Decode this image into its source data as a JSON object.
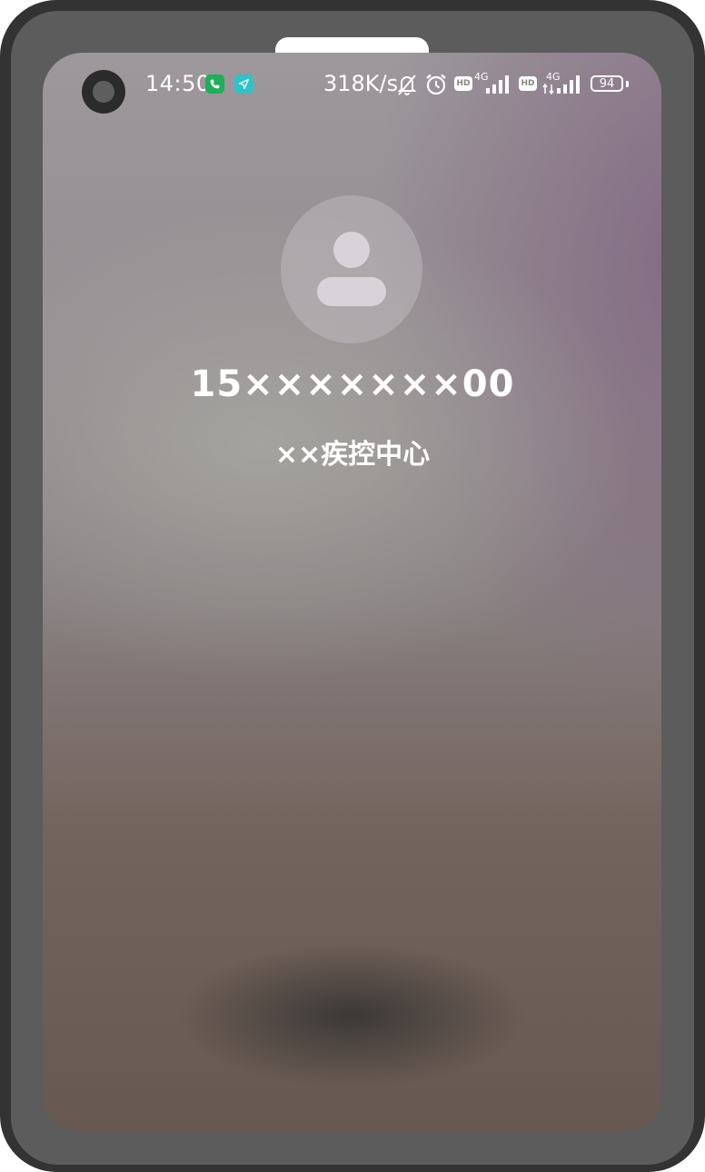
{
  "status_bar": {
    "time": "14:50",
    "net_speed": "318K/s",
    "network_type": "4G",
    "hd_label": "HD",
    "battery_level": "94",
    "icons": [
      "phone-call-icon",
      "navigation-icon",
      "bell-muted-icon",
      "alarm-icon",
      "hd-icon",
      "signal-icon",
      "battery-icon"
    ]
  },
  "call": {
    "number": "15×××××××00",
    "label": "××疾控中心"
  },
  "colors": {
    "phone_badge": "#1fae5a",
    "nav_badge": "#2fc3c9",
    "frame": "#333333",
    "bezel": "#5c5c5c"
  }
}
